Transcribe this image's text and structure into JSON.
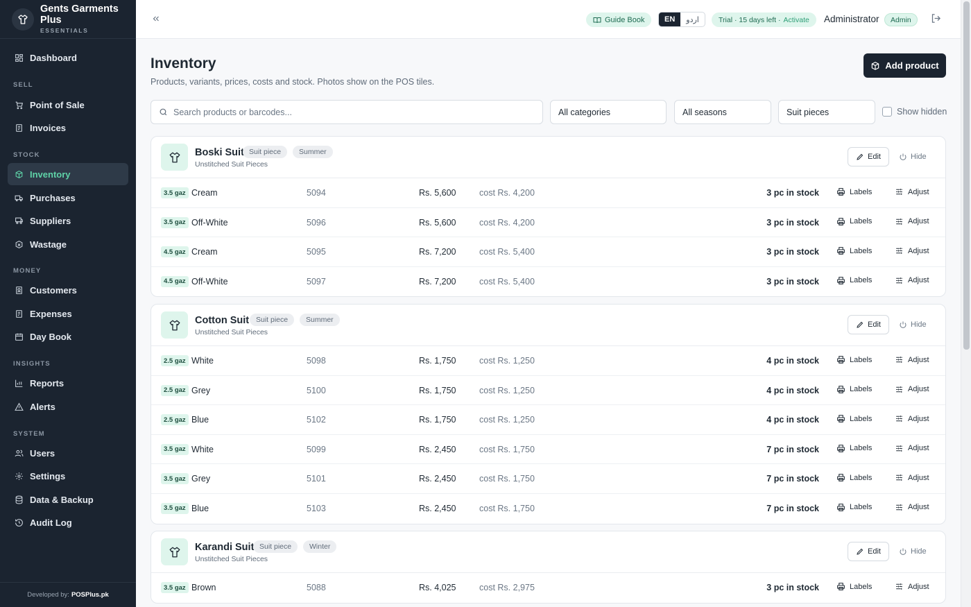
{
  "brand": {
    "name": "Gents Garments Plus",
    "subtitle": "ESSENTIALS"
  },
  "nav": {
    "items": [
      {
        "label": "Dashboard",
        "icon": "dashboard-icon"
      },
      {
        "label": "Point of Sale",
        "icon": "cart-icon"
      },
      {
        "label": "Invoices",
        "icon": "invoice-icon"
      },
      {
        "label": "Inventory",
        "icon": "box-icon",
        "active": true
      },
      {
        "label": "Purchases",
        "icon": "truck-icon"
      },
      {
        "label": "Suppliers",
        "icon": "suppliers-icon"
      },
      {
        "label": "Wastage",
        "icon": "wastage-icon"
      },
      {
        "label": "Customers",
        "icon": "customers-icon"
      },
      {
        "label": "Expenses",
        "icon": "expenses-icon"
      },
      {
        "label": "Day Book",
        "icon": "calendar-icon"
      },
      {
        "label": "Reports",
        "icon": "chart-icon"
      },
      {
        "label": "Alerts",
        "icon": "alert-icon"
      },
      {
        "label": "Users",
        "icon": "users-icon"
      },
      {
        "label": "Settings",
        "icon": "gear-icon"
      },
      {
        "label": "Data & Backup",
        "icon": "database-icon"
      },
      {
        "label": "Audit Log",
        "icon": "history-icon"
      }
    ],
    "sections": [
      "SELL",
      "STOCK",
      "MONEY",
      "INSIGHTS",
      "SYSTEM"
    ]
  },
  "footer": {
    "prefix": "Developed by:",
    "company": "POSPlus.pk"
  },
  "topbar": {
    "guide": "Guide Book",
    "lang_en": "EN",
    "lang_ur": "اردو",
    "trial": "Trial · 15 days left ·",
    "activate": "Activate",
    "user": "Administrator",
    "role": "Admin"
  },
  "page": {
    "title": "Inventory",
    "subtitle": "Products, variants, prices, costs and stock. Photos show on the POS tiles.",
    "add_button": "Add product"
  },
  "filters": {
    "search_placeholder": "Search products or barcodes...",
    "category": "All categories",
    "season": "All seasons",
    "type": "Suit pieces",
    "show_hidden": "Show hidden"
  },
  "actions": {
    "edit": "Edit",
    "hide": "Hide",
    "labels": "Labels",
    "adjust": "Adjust"
  },
  "products": [
    {
      "name": "Boski Suit",
      "type": "Suit piece",
      "season": "Summer",
      "category": "Unstitched Suit Pieces",
      "variants": [
        {
          "size": "3.5 gaz",
          "color": "Cream",
          "code": "5094",
          "price": "Rs. 5,600",
          "cost": "cost Rs. 4,200",
          "stock": "3 pc in stock"
        },
        {
          "size": "3.5 gaz",
          "color": "Off-White",
          "code": "5096",
          "price": "Rs. 5,600",
          "cost": "cost Rs. 4,200",
          "stock": "3 pc in stock"
        },
        {
          "size": "4.5 gaz",
          "color": "Cream",
          "code": "5095",
          "price": "Rs. 7,200",
          "cost": "cost Rs. 5,400",
          "stock": "3 pc in stock"
        },
        {
          "size": "4.5 gaz",
          "color": "Off-White",
          "code": "5097",
          "price": "Rs. 7,200",
          "cost": "cost Rs. 5,400",
          "stock": "3 pc in stock"
        }
      ]
    },
    {
      "name": "Cotton Suit",
      "type": "Suit piece",
      "season": "Summer",
      "category": "Unstitched Suit Pieces",
      "variants": [
        {
          "size": "2.5 gaz",
          "color": "White",
          "code": "5098",
          "price": "Rs. 1,750",
          "cost": "cost Rs. 1,250",
          "stock": "4 pc in stock"
        },
        {
          "size": "2.5 gaz",
          "color": "Grey",
          "code": "5100",
          "price": "Rs. 1,750",
          "cost": "cost Rs. 1,250",
          "stock": "4 pc in stock"
        },
        {
          "size": "2.5 gaz",
          "color": "Blue",
          "code": "5102",
          "price": "Rs. 1,750",
          "cost": "cost Rs. 1,250",
          "stock": "4 pc in stock"
        },
        {
          "size": "3.5 gaz",
          "color": "White",
          "code": "5099",
          "price": "Rs. 2,450",
          "cost": "cost Rs. 1,750",
          "stock": "7 pc in stock"
        },
        {
          "size": "3.5 gaz",
          "color": "Grey",
          "code": "5101",
          "price": "Rs. 2,450",
          "cost": "cost Rs. 1,750",
          "stock": "7 pc in stock"
        },
        {
          "size": "3.5 gaz",
          "color": "Blue",
          "code": "5103",
          "price": "Rs. 2,450",
          "cost": "cost Rs. 1,750",
          "stock": "7 pc in stock"
        }
      ]
    },
    {
      "name": "Karandi Suit",
      "type": "Suit piece",
      "season": "Winter",
      "category": "Unstitched Suit Pieces",
      "variants": [
        {
          "size": "3.5 gaz",
          "color": "Brown",
          "code": "5088",
          "price": "Rs. 4,025",
          "cost": "cost Rs. 2,975",
          "stock": "3 pc in stock"
        }
      ]
    }
  ],
  "colors": {
    "sidebar": "#1b2430",
    "accent": "#5fd3a8",
    "accent_soft": "#def5ec",
    "primary_button": "#1b2430"
  }
}
